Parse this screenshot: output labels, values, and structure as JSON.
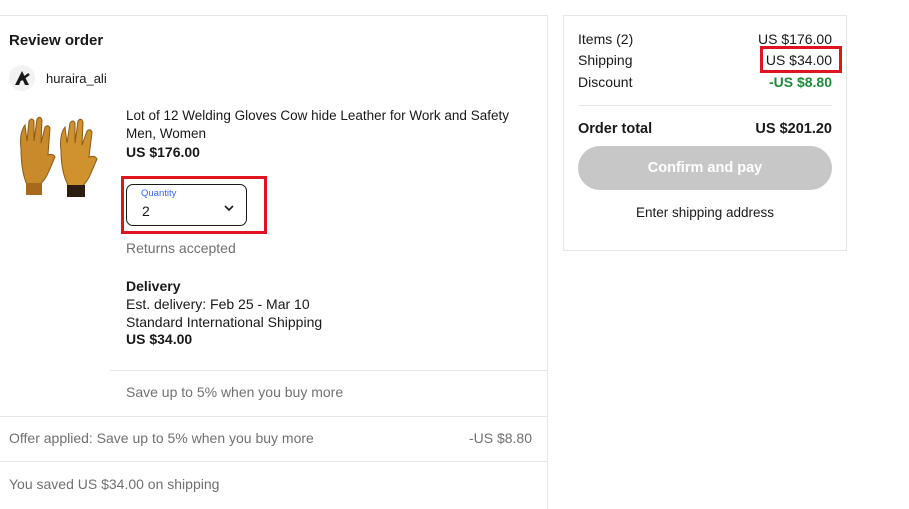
{
  "review": {
    "title": "Review order",
    "seller_name": "huraira_ali",
    "item": {
      "title": "Lot of 12 Welding Gloves Cow hide Leather for Work and Safety Men, Women",
      "price": "US $176.00",
      "image_icon": "leather-gloves-image",
      "quantity_label": "Quantity",
      "quantity_value": "2",
      "returns": "Returns accepted"
    },
    "delivery": {
      "heading": "Delivery",
      "estimate": "Est. delivery: Feb 25 - Mar 10",
      "method": "Standard International Shipping",
      "price": "US $34.00"
    },
    "save_more": "Save up to 5% when you buy more",
    "offer": {
      "text": "Offer applied: Save up to 5% when you buy more",
      "amount": "-US $8.80"
    },
    "saved_shipping": "You saved US $34.00 on shipping"
  },
  "summary": {
    "items_label": "Items (2)",
    "items_value": "US $176.00",
    "shipping_label": "Shipping",
    "shipping_value": "US $34.00",
    "discount_label": "Discount",
    "discount_value": "-US $8.80",
    "total_label": "Order total",
    "total_value": "US $201.20",
    "confirm_button": "Confirm and pay",
    "enter_address": "Enter shipping address"
  },
  "colors": {
    "highlight": "#e0141e",
    "discount": "#1d8b3a",
    "accent_blue": "#3665f3",
    "button_disabled": "#c7c7c7"
  }
}
